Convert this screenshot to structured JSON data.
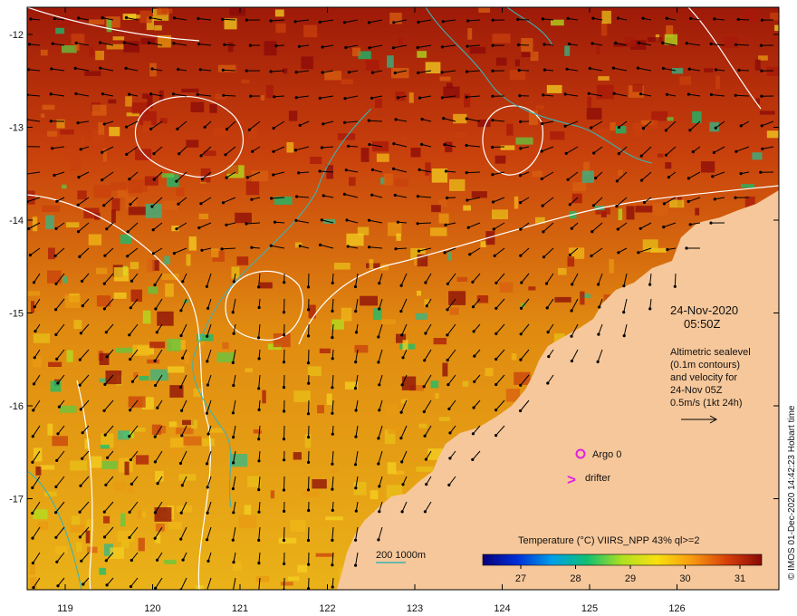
{
  "map": {
    "lon_ticks": [
      "119",
      "120",
      "121",
      "122",
      "123",
      "124",
      "125",
      "126"
    ],
    "lat_ticks": [
      "-12",
      "-13",
      "-14",
      "-15",
      "-16",
      "-17"
    ],
    "date_line1": "24-Nov-2020",
    "date_line2": "05:50Z",
    "info_lines": [
      "Altimetric sealevel",
      "(0.1m contours)",
      "and velocity for",
      "24-Nov 05Z",
      "0.5m/s (1kt 24h)"
    ],
    "argo_label": "Argo 0",
    "drifter_label": "drifter",
    "drifter_symbol": ">",
    "depth_label": "200  1000m",
    "colorbar_title": "Temperature (°C) VIIRS_NPP 43% ql>=2",
    "colorbar_ticks": [
      "27",
      "28",
      "29",
      "30",
      "31"
    ],
    "credit": "© IMOS 01-Dec-2020 14:42:23 Hobart time"
  },
  "colors": {
    "land": "#f6c79a",
    "contour": "#ffffff",
    "isobath": "#3ab4b4",
    "marker": "#e020e0",
    "colormap": [
      "#08007a",
      "#0030d8",
      "#00a0e8",
      "#10c070",
      "#b0e020",
      "#f8e010",
      "#f89a10",
      "#d8400a",
      "#8a0a08"
    ]
  }
}
